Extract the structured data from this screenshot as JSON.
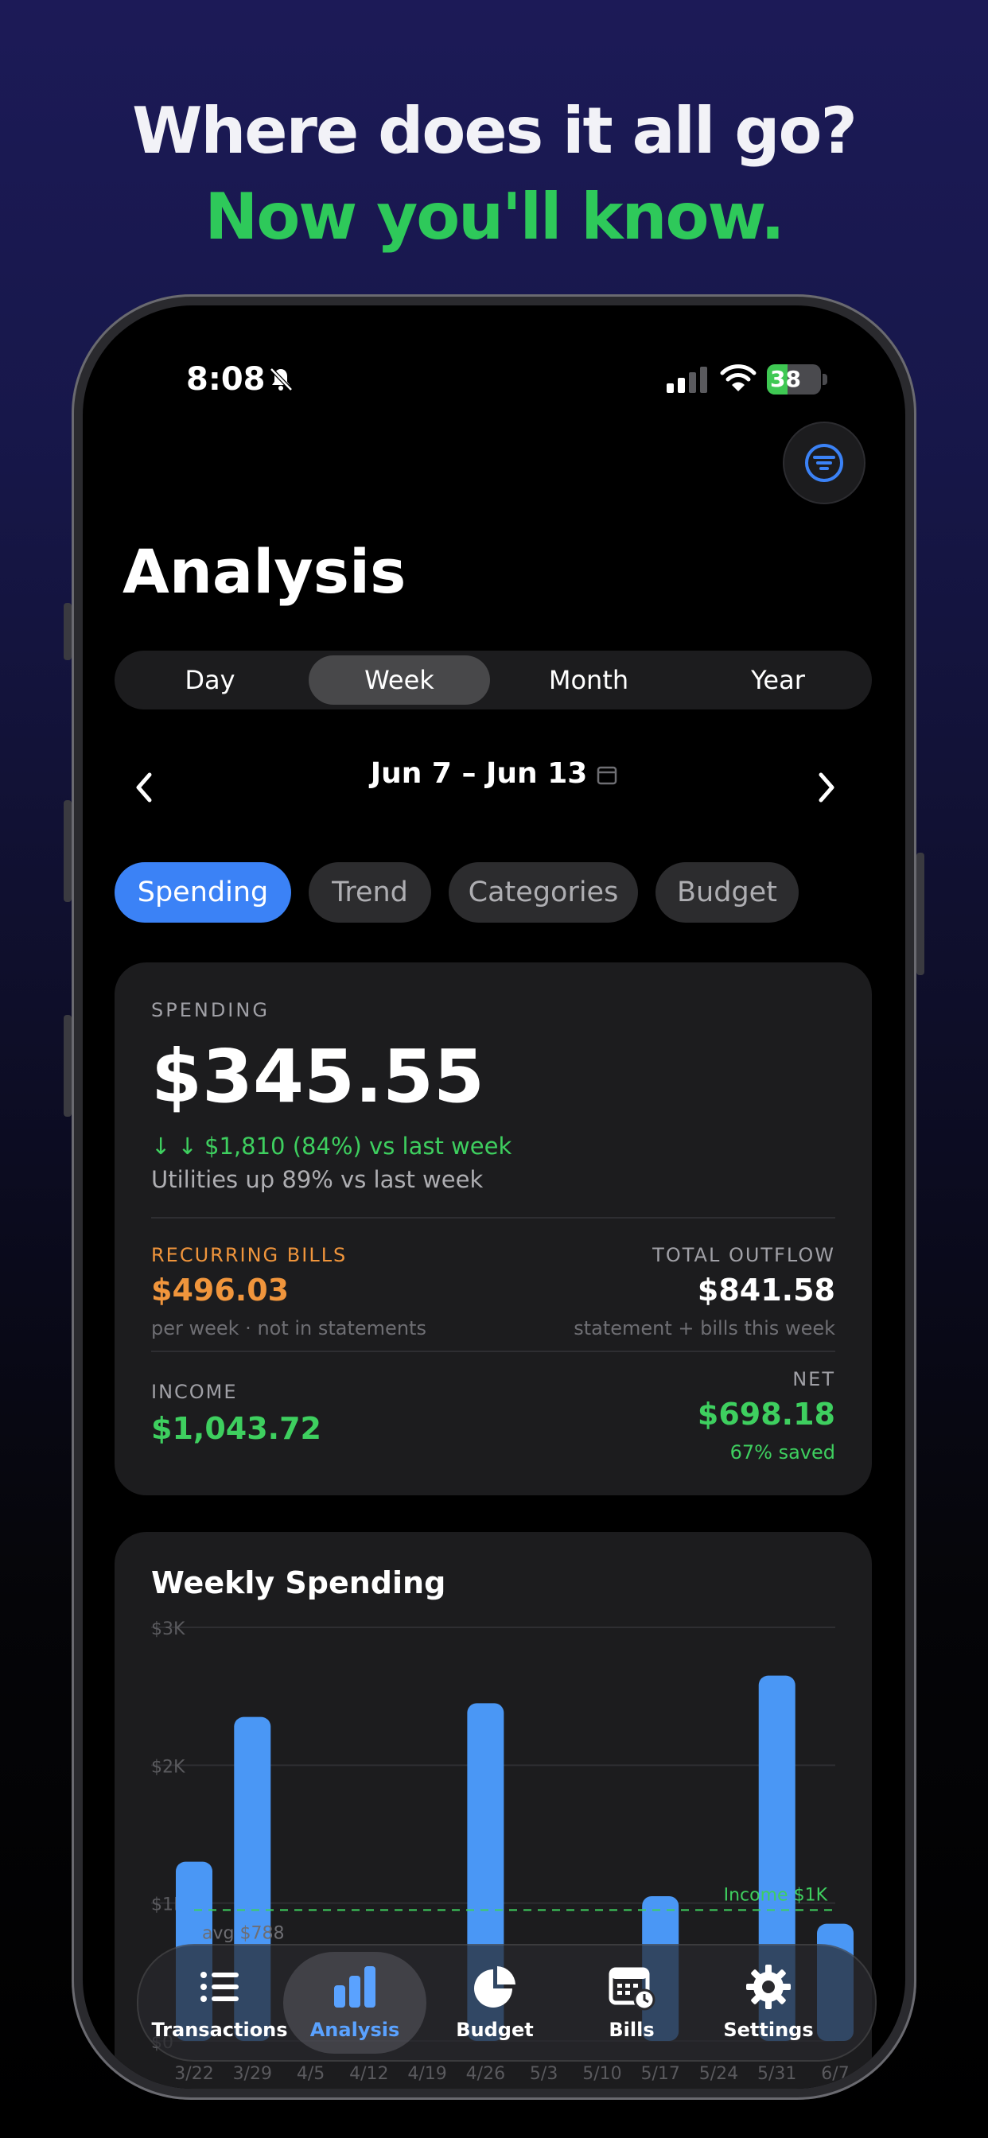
{
  "promo": {
    "headline_line1": "Where does it all go?",
    "headline_line2": "Now you'll know."
  },
  "status_bar": {
    "time": "8:08",
    "battery": "38",
    "battery_level_pct": 38
  },
  "colors": {
    "accent": "#3b82f6",
    "green": "#3ecf5f",
    "orange": "#f0953c",
    "bar": "#4a97f5"
  },
  "page": {
    "title": "Analysis"
  },
  "period_segments": [
    {
      "label": "Day",
      "active": false
    },
    {
      "label": "Week",
      "active": true
    },
    {
      "label": "Month",
      "active": false
    },
    {
      "label": "Year",
      "active": false
    }
  ],
  "period": {
    "range_label": "Jun 7 – Jun 13"
  },
  "view_chips": [
    {
      "label": "Spending",
      "active": true
    },
    {
      "label": "Trend",
      "active": false
    },
    {
      "label": "Categories",
      "active": false
    },
    {
      "label": "Budget",
      "active": false
    }
  ],
  "summary": {
    "spending_label": "SPENDING",
    "spending_amount": "$345.55",
    "delta_text": "↓ ↓ $1,810 (84%) vs last week",
    "insight_text": "Utilities up 89% vs last week",
    "recurring_label": "RECURRING BILLS",
    "recurring_amount": "$496.03",
    "recurring_note": "per week · not in statements",
    "outflow_label": "TOTAL OUTFLOW",
    "outflow_amount": "$841.58",
    "outflow_note": "statement + bills this week",
    "income_label": "INCOME",
    "income_amount": "$1,043.72",
    "net_label": "NET",
    "net_amount": "$698.18",
    "net_note": "67% saved"
  },
  "chart_data": {
    "type": "bar",
    "title": "Weekly Spending",
    "categories": [
      "3/22",
      "3/29",
      "4/5",
      "4/12",
      "4/19",
      "4/26",
      "5/3",
      "5/10",
      "5/17",
      "5/24",
      "5/31",
      "6/7"
    ],
    "values": [
      1300,
      2350,
      0,
      0,
      0,
      2450,
      0,
      0,
      1050,
      0,
      2650,
      850
    ],
    "y_ticks": [
      "$0",
      "$1K",
      "$2K",
      "$3K"
    ],
    "y_tick_values": [
      0,
      1000,
      2000,
      3000
    ],
    "ylim": [
      0,
      3000
    ],
    "reference_lines": [
      {
        "label": "Income $1K",
        "value": 950
      },
      {
        "label": "avg $788",
        "value": 788
      }
    ],
    "grid": true
  },
  "tabbar": {
    "items": [
      {
        "label": "Transactions",
        "icon": "list-icon",
        "active": false
      },
      {
        "label": "Analysis",
        "icon": "bar-chart-icon",
        "active": true
      },
      {
        "label": "Budget",
        "icon": "pie-chart-icon",
        "active": false
      },
      {
        "label": "Bills",
        "icon": "calendar-clock-icon",
        "active": false
      },
      {
        "label": "Settings",
        "icon": "gear-icon",
        "active": false
      }
    ]
  }
}
